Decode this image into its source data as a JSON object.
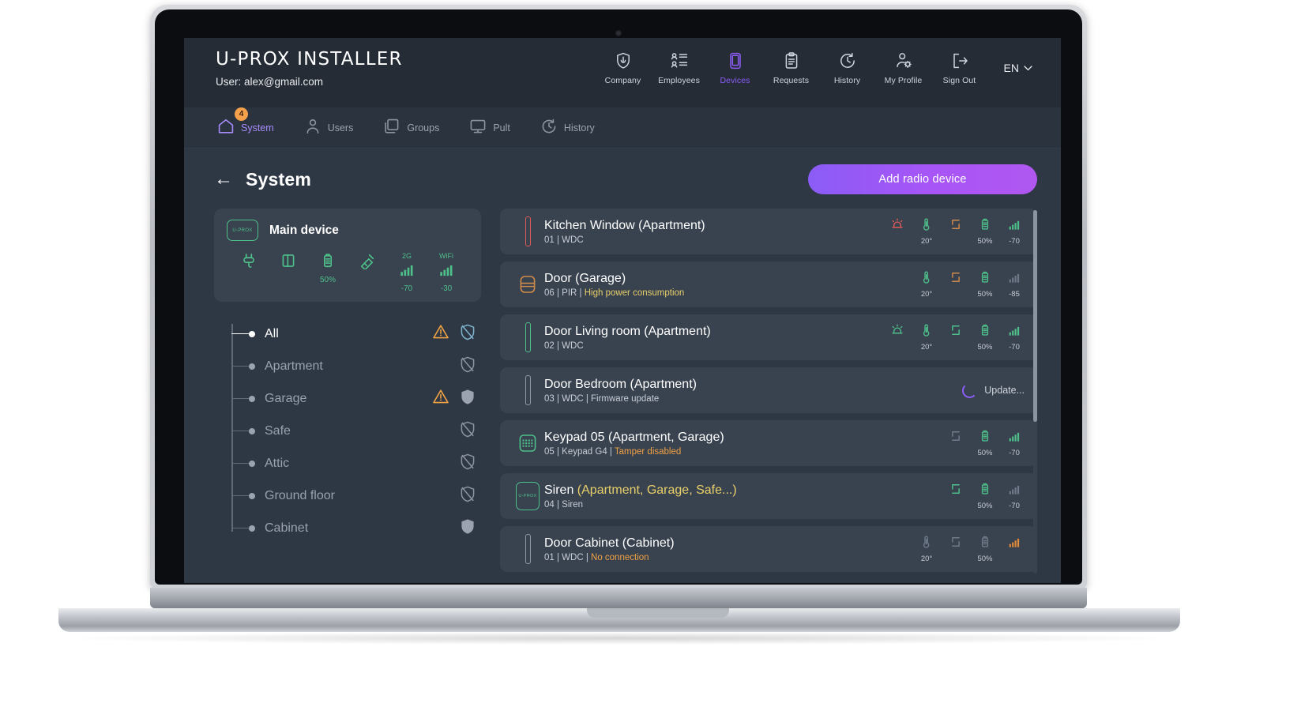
{
  "brand": {
    "name_bold": "U-PROX",
    "name_light": "INSTALLER",
    "user_line": "User: alex@gmail.com"
  },
  "topnav": {
    "lang": "EN",
    "items": [
      {
        "label": "Company",
        "icon": "shield-icon",
        "active": false
      },
      {
        "label": "Employees",
        "icon": "employees-icon",
        "active": false
      },
      {
        "label": "Devices",
        "icon": "device-icon",
        "active": true
      },
      {
        "label": "Requests",
        "icon": "clipboard-icon",
        "active": false
      },
      {
        "label": "History",
        "icon": "clock-icon",
        "active": false
      },
      {
        "label": "My Profile",
        "icon": "profile-gear-icon",
        "active": false
      },
      {
        "label": "Sign Out",
        "icon": "sign-out-icon",
        "active": false
      }
    ]
  },
  "subnav": {
    "items": [
      {
        "label": "System",
        "icon": "home-icon",
        "active": true,
        "badge": "4"
      },
      {
        "label": "Users",
        "icon": "user-icon",
        "active": false,
        "badge": ""
      },
      {
        "label": "Groups",
        "icon": "groups-icon",
        "active": false,
        "badge": ""
      },
      {
        "label": "Pult",
        "icon": "monitor-icon",
        "active": false,
        "badge": ""
      },
      {
        "label": "History",
        "icon": "history-icon",
        "active": false,
        "badge": ""
      }
    ]
  },
  "page": {
    "back_label": "←",
    "title": "System",
    "add_button": "Add radio device"
  },
  "main_device": {
    "chip_label": "U-PROX",
    "title": "Main device",
    "stats": [
      {
        "icon": "power-plug-icon",
        "value": "",
        "name": "external-power"
      },
      {
        "icon": "tamper-icon",
        "value": "",
        "name": "tamper"
      },
      {
        "icon": "battery-icon",
        "value": "50%",
        "name": "battery"
      },
      {
        "icon": "antenna-icon",
        "value": "",
        "name": "antenna"
      },
      {
        "icon": "signal-icon",
        "value": "-70",
        "name": "cellular",
        "net": "2G"
      },
      {
        "icon": "signal-icon",
        "value": "-30",
        "name": "wifi",
        "net": "WiFi"
      }
    ]
  },
  "zones": [
    {
      "label": "All",
      "active": true,
      "warning": true,
      "shield": "disarmed-active"
    },
    {
      "label": "Apartment",
      "active": false,
      "warning": false,
      "shield": "disarmed"
    },
    {
      "label": "Garage",
      "active": false,
      "warning": true,
      "shield": "armed"
    },
    {
      "label": "Safe",
      "active": false,
      "warning": false,
      "shield": "disarmed"
    },
    {
      "label": "Attic",
      "active": false,
      "warning": false,
      "shield": "disarmed"
    },
    {
      "label": "Ground floor",
      "active": false,
      "warning": false,
      "shield": "disarmed"
    },
    {
      "label": "Cabinet",
      "active": false,
      "warning": false,
      "shield": "armed"
    }
  ],
  "devices": [
    {
      "icon": "door-sensor-icon",
      "icon_color": "#e05a5a",
      "icon_kind": "bar",
      "name": "Kitchen Window (Apartment)",
      "zones_warn": "",
      "sub_main": "01 | WDC",
      "sub_alert": "",
      "sub_alert_color": "",
      "updating": false,
      "update_label": "",
      "stats": [
        {
          "icon": "siren-icon",
          "value": "",
          "color": "#e05a5a"
        },
        {
          "icon": "temp-icon",
          "value": "20°",
          "color": "#4ec08a"
        },
        {
          "icon": "tamper-icon",
          "value": "",
          "color": "#d08b4a"
        },
        {
          "icon": "battery-icon",
          "value": "50%",
          "color": "#4ec08a"
        },
        {
          "icon": "signal-icon",
          "value": "-70",
          "color": "#4ec08a"
        }
      ]
    },
    {
      "icon": "pir-icon",
      "icon_color": "#d08b4a",
      "icon_kind": "box",
      "name": "Door (Garage)",
      "zones_warn": "",
      "sub_main": "06 | PIR | ",
      "sub_alert": "High power consumption",
      "sub_alert_color": "#e8d06a",
      "updating": false,
      "update_label": "",
      "stats": [
        {
          "icon": "temp-icon",
          "value": "20°",
          "color": "#4ec08a"
        },
        {
          "icon": "tamper-icon",
          "value": "",
          "color": "#d08b4a"
        },
        {
          "icon": "battery-icon",
          "value": "50%",
          "color": "#4ec08a"
        },
        {
          "icon": "signal-icon",
          "value": "-85",
          "color": "#6f7b8a"
        }
      ]
    },
    {
      "icon": "door-sensor-icon",
      "icon_color": "#4ec08a",
      "icon_kind": "bar",
      "name": "Door Living room (Apartment)",
      "zones_warn": "",
      "sub_main": "02 | WDC",
      "sub_alert": "",
      "sub_alert_color": "",
      "updating": false,
      "update_label": "",
      "stats": [
        {
          "icon": "siren-icon",
          "value": "",
          "color": "#4ec08a"
        },
        {
          "icon": "temp-icon",
          "value": "20°",
          "color": "#4ec08a"
        },
        {
          "icon": "tamper-icon",
          "value": "",
          "color": "#4ec08a"
        },
        {
          "icon": "battery-icon",
          "value": "50%",
          "color": "#4ec08a"
        },
        {
          "icon": "signal-icon",
          "value": "-70",
          "color": "#4ec08a"
        }
      ]
    },
    {
      "icon": "door-sensor-icon",
      "icon_color": "#8f99a6",
      "icon_kind": "bar",
      "name": "Door Bedroom (Apartment)",
      "zones_warn": "",
      "sub_main": "03 | WDC | Firmware update",
      "sub_alert": "",
      "sub_alert_color": "",
      "updating": true,
      "update_label": "Update...",
      "stats": []
    },
    {
      "icon": "keypad-icon",
      "icon_color": "#4ec08a",
      "icon_kind": "box",
      "name": "Keypad 05 (Apartment, Garage)",
      "zones_warn": "",
      "sub_main": "05 | Keypad G4 | ",
      "sub_alert": "Tamper disabled",
      "sub_alert_color": "#f0a244",
      "updating": false,
      "update_label": "",
      "stats": [
        {
          "icon": "tamper-icon",
          "value": "",
          "color": "#6f7b8a"
        },
        {
          "icon": "battery-icon",
          "value": "50%",
          "color": "#4ec08a"
        },
        {
          "icon": "signal-icon",
          "value": "-70",
          "color": "#4ec08a"
        }
      ]
    },
    {
      "icon": "siren-device-icon",
      "icon_color": "#4ec08a",
      "icon_kind": "box",
      "name": "Siren ",
      "zones_warn": "(Apartment, Garage, Safe...)",
      "sub_main": "04 | Siren",
      "sub_alert": "",
      "sub_alert_color": "",
      "updating": false,
      "update_label": "",
      "stats": [
        {
          "icon": "tamper-icon",
          "value": "",
          "color": "#4ec08a"
        },
        {
          "icon": "battery-icon",
          "value": "50%",
          "color": "#4ec08a"
        },
        {
          "icon": "signal-icon",
          "value": "-70",
          "color": "#6f7b8a"
        }
      ]
    },
    {
      "icon": "door-sensor-icon",
      "icon_color": "#8f99a6",
      "icon_kind": "bar",
      "name": "Door Cabinet (Cabinet)",
      "zones_warn": "",
      "sub_main": "01 | WDC | ",
      "sub_alert": "No connection",
      "sub_alert_color": "#f0a244",
      "updating": false,
      "update_label": "",
      "stats": [
        {
          "icon": "temp-icon",
          "value": "20°",
          "color": "#6f7b8a"
        },
        {
          "icon": "tamper-icon",
          "value": "",
          "color": "#6f7b8a"
        },
        {
          "icon": "battery-icon",
          "value": "50%",
          "color": "#6f7b8a"
        },
        {
          "icon": "signal-icon",
          "value": "",
          "color": "#e08a3a"
        }
      ]
    }
  ],
  "colors": {
    "accent_purple": "#8b5cf6",
    "green": "#4ec08a",
    "orange": "#f0a244",
    "red": "#e05a5a",
    "yellow": "#e8d06a",
    "panel": "#39424f",
    "bg": "#2e3744"
  }
}
